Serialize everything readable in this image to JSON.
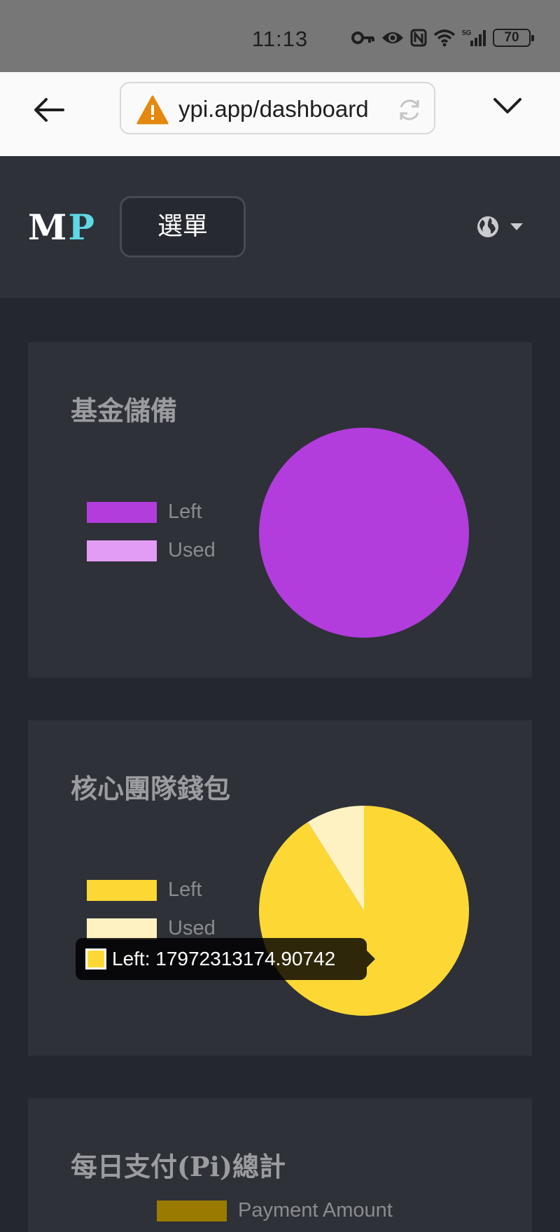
{
  "status_bar": {
    "time": "11:13",
    "battery": "70",
    "network": "5G"
  },
  "browser": {
    "url": "ypi.app/dashboard",
    "warning_color": "#e4880e"
  },
  "header": {
    "logo_m": "M",
    "logo_p": "P",
    "menu_label": "選單"
  },
  "cards": [
    {
      "title": "基金儲備",
      "legend": [
        {
          "label": "Left",
          "color": "#b23ddc"
        },
        {
          "label": "Used",
          "color": "#e39cf5"
        }
      ]
    },
    {
      "title": "核心團隊錢包",
      "legend": [
        {
          "label": "Left",
          "color": "#fdd835"
        },
        {
          "label": "Used",
          "color": "#fff2c2"
        }
      ],
      "tooltip": {
        "label": "Left: 17972313174.90742",
        "color": "#fdd835"
      }
    },
    {
      "title": "每日支付(Pi)總計",
      "legend": [
        {
          "label": "Payment Amount",
          "color": "#9a7b00"
        }
      ]
    }
  ],
  "chart_data": [
    {
      "type": "pie",
      "title": "基金儲備",
      "categories": [
        "Left",
        "Used"
      ],
      "values": [
        100,
        0
      ],
      "colors": [
        "#b23ddc",
        "#e39cf5"
      ],
      "legend": "left"
    },
    {
      "type": "pie",
      "title": "核心團隊錢包",
      "categories": [
        "Left",
        "Used"
      ],
      "values": [
        91,
        9
      ],
      "colors": [
        "#fdd835",
        "#fff2c2"
      ],
      "legend": "left",
      "highlighted_value": "17972313174.90742"
    }
  ]
}
